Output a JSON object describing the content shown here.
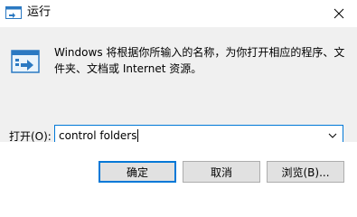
{
  "window": {
    "title": "运行",
    "icon": "run-app-icon",
    "close_icon": "close-icon"
  },
  "main": {
    "description": "Windows 将根据你所输入的名称，为你打开相应的程序、文件夹、文档或 Internet 资源。",
    "open_label": "打开(O):",
    "open_value": "control folders",
    "run_icon": "run-icon",
    "dropdown_icon": "chevron-down-icon"
  },
  "buttons": {
    "ok": "确定",
    "cancel": "取消",
    "browse": "浏览(B)..."
  },
  "colors": {
    "accent": "#0078d7",
    "panel": "#f0f0f0",
    "button_face": "#e1e1e1",
    "button_border": "#adadad"
  }
}
